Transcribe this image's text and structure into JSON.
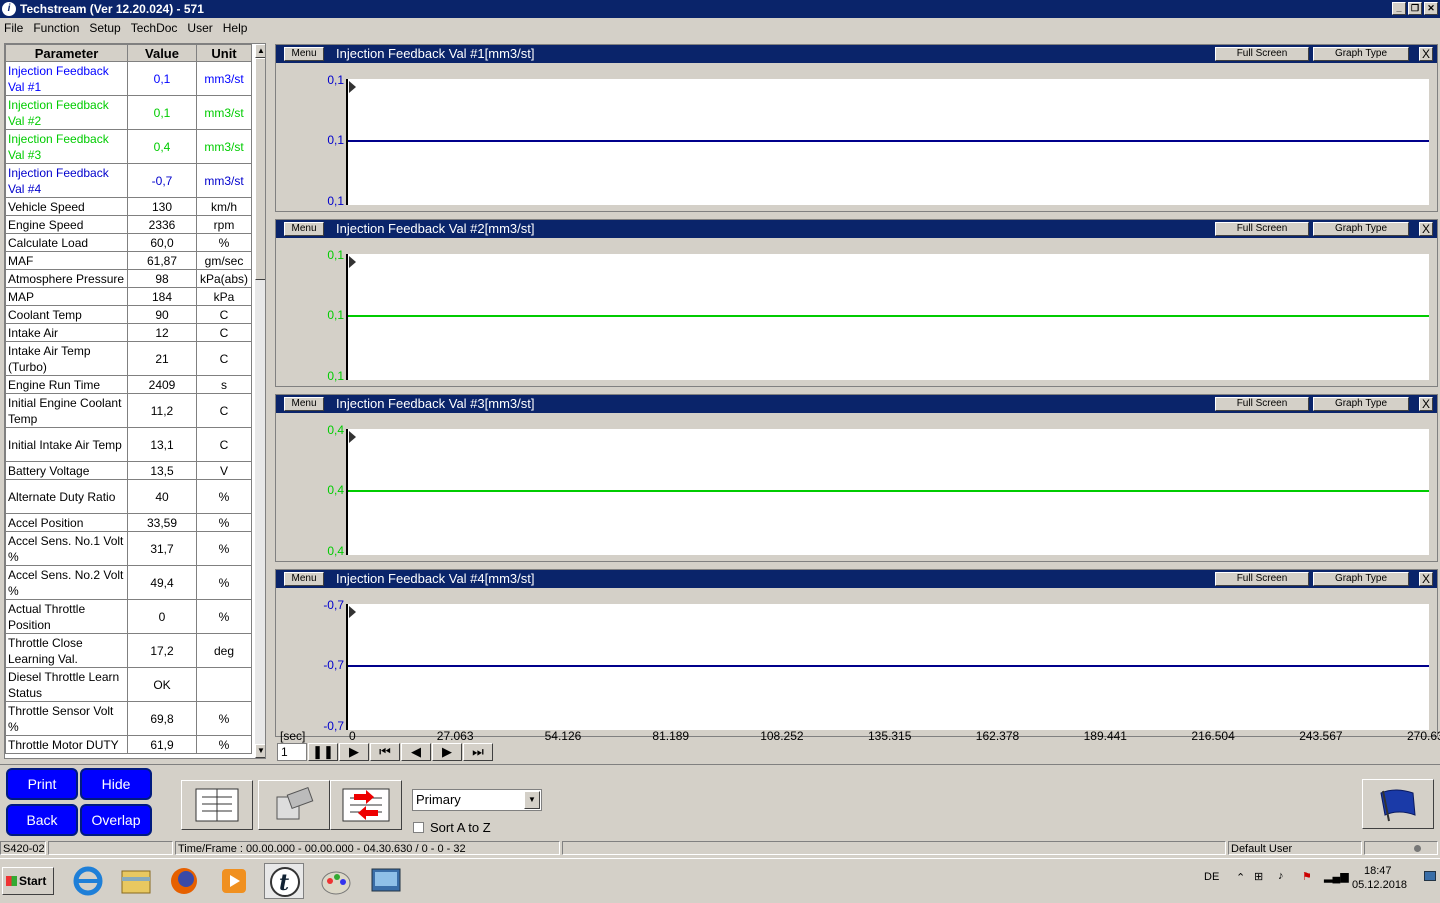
{
  "window": {
    "title": "Techstream (Ver 12.20.024) - 571"
  },
  "menu": [
    "File",
    "Function",
    "Setup",
    "TechDoc",
    "User",
    "Help"
  ],
  "table": {
    "headers": [
      "Parameter",
      "Value",
      "Unit"
    ],
    "rows": [
      {
        "p": "Injection Feedback Val #1",
        "v": "0,1",
        "u": "mm3/st",
        "color": "#0000ff"
      },
      {
        "p": "Injection Feedback Val #2",
        "v": "0,1",
        "u": "mm3/st",
        "color": "#00cc00"
      },
      {
        "p": "Injection Feedback Val #3",
        "v": "0,4",
        "u": "mm3/st",
        "color": "#00cc00"
      },
      {
        "p": "Injection Feedback Val #4",
        "v": "-0,7",
        "u": "mm3/st",
        "color": "#0000cc"
      },
      {
        "p": "Vehicle Speed",
        "v": "130",
        "u": "km/h"
      },
      {
        "p": "Engine Speed",
        "v": "2336",
        "u": "rpm"
      },
      {
        "p": "Calculate Load",
        "v": "60,0",
        "u": "%"
      },
      {
        "p": "MAF",
        "v": "61,87",
        "u": "gm/sec"
      },
      {
        "p": "Atmosphere Pressure",
        "v": "98",
        "u": "kPa(abs)"
      },
      {
        "p": "MAP",
        "v": "184",
        "u": "kPa"
      },
      {
        "p": "Coolant Temp",
        "v": "90",
        "u": "C"
      },
      {
        "p": "Intake Air",
        "v": "12",
        "u": "C"
      },
      {
        "p": "Intake Air Temp (Turbo)",
        "v": "21",
        "u": "C"
      },
      {
        "p": "Engine Run Time",
        "v": "2409",
        "u": "s"
      },
      {
        "p": "Initial Engine Coolant Temp",
        "v": "11,2",
        "u": "C"
      },
      {
        "p": "Initial Intake Air Temp",
        "v": "13,1",
        "u": "C"
      },
      {
        "p": "Battery Voltage",
        "v": "13,5",
        "u": "V"
      },
      {
        "p": "Alternate Duty Ratio",
        "v": "40",
        "u": "%"
      },
      {
        "p": "Accel Position",
        "v": "33,59",
        "u": "%"
      },
      {
        "p": "Accel Sens. No.1 Volt %",
        "v": "31,7",
        "u": "%"
      },
      {
        "p": "Accel Sens. No.2 Volt %",
        "v": "49,4",
        "u": "%"
      },
      {
        "p": "Actual Throttle Position",
        "v": "0",
        "u": "%"
      },
      {
        "p": "Throttle Close Learning Val.",
        "v": "17,2",
        "u": "deg"
      },
      {
        "p": "Diesel Throttle Learn Status",
        "v": "OK",
        "u": ""
      },
      {
        "p": "Throttle Sensor Volt %",
        "v": "69,8",
        "u": "%"
      },
      {
        "p": "Throttle Motor DUTY",
        "v": "61,9",
        "u": "%"
      }
    ]
  },
  "graphs": [
    {
      "title": "Injection Feedback Val #1[mm3/st]",
      "menu": "Menu",
      "full": "Full Screen",
      "type": "Graph Type",
      "close": "X",
      "ylabels": [
        "0,1",
        "0,1",
        "0,1"
      ],
      "color": "#00008b",
      "labelcolor": "#0000cc"
    },
    {
      "title": "Injection Feedback Val #2[mm3/st]",
      "menu": "Menu",
      "full": "Full Screen",
      "type": "Graph Type",
      "close": "X",
      "ylabels": [
        "0,1",
        "0,1",
        "0,1"
      ],
      "color": "#00cc00",
      "labelcolor": "#00cc00"
    },
    {
      "title": "Injection Feedback Val #3[mm3/st]",
      "menu": "Menu",
      "full": "Full Screen",
      "type": "Graph Type",
      "close": "X",
      "ylabels": [
        "0,4",
        "0,4",
        "0,4"
      ],
      "color": "#00cc00",
      "labelcolor": "#00cc00"
    },
    {
      "title": "Injection Feedback Val #4[mm3/st]",
      "menu": "Menu",
      "full": "Full Screen",
      "type": "Graph Type",
      "close": "X",
      "ylabels": [
        "-0,7",
        "-0,7",
        "-0,7"
      ],
      "color": "#00008b",
      "labelcolor": "#0000cc"
    }
  ],
  "time_axis": {
    "unit": "[sec]",
    "ticks": [
      "0",
      "27.063",
      "54.126",
      "81.189",
      "108.252",
      "135.315",
      "162.378",
      "189.441",
      "216.504",
      "243.567",
      "270.63"
    ]
  },
  "frame": "1",
  "buttons": {
    "print": "Print",
    "hide": "Hide",
    "back": "Back",
    "overlap": "Overlap"
  },
  "select": {
    "value": "Primary"
  },
  "checkbox": {
    "label": "Sort A to Z"
  },
  "status": {
    "code": "S420-02",
    "timeframe": "Time/Frame : 00.00.000 - 00.00.000 - 04.30.630 / 0 - 0 - 32",
    "user": "Default User"
  },
  "taskbar": {
    "start": "Start",
    "lang": "DE",
    "time": "18:47",
    "date": "05.12.2018"
  }
}
